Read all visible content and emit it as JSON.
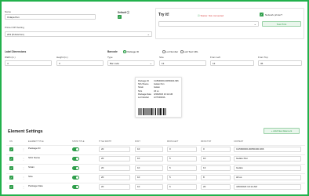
{
  "form": {
    "name_label": "Name",
    "name_value": "Oxlapa Pen",
    "default_label": "Default",
    "printer_dpi_label": "Printer DPI Setting",
    "printer_dpi_value": "203 (8 dots/mm)",
    "label_dimensions_label": "Label Dimensions",
    "width_label": "Width (in.)",
    "width_value": "4",
    "height_label": "Height (in.)",
    "height_value": "3"
  },
  "tryit": {
    "title": "Try it!",
    "status_text": "Status: Not connected",
    "status_icon": "check-square-icon",
    "network_printer_label": "Network printer?",
    "test_print_label": "Test Print"
  },
  "barcode": {
    "label": "Barcode",
    "options": [
      "Package ID",
      "Lot Number",
      "Lab Test URL"
    ],
    "type_label": "Type",
    "type_value": "Bar code",
    "size_label": "Size",
    "size_value": "13",
    "from_left_label": "From Left",
    "from_left_value": "12",
    "from_top_label": "From Top",
    "from_top_value": "36"
  },
  "preview": {
    "lines": [
      {
        "k": "Package ID",
        "v": "CA5M0000-00050400-996"
      },
      {
        "k": "SKU Name",
        "v": "Gelato Pen"
      },
      {
        "k": "Strain",
        "v": "Gelato"
      },
      {
        "k": "Size",
        "v": "All us"
      },
      {
        "k": "Package Date",
        "v": "4/30/2023 10:12 AM"
      },
      {
        "k": "Lot Number",
        "v": "LOT10023A"
      }
    ]
  },
  "elements": {
    "title": "Element Settings",
    "add_button": "+ Add New Element",
    "headers": [
      "ON",
      "ELEMENT TITLE",
      "SHOW TITLE",
      "TITLE WIDTH",
      "FONT",
      "FROM LEFT",
      "FROM TOP",
      "CONTENT"
    ],
    "rows": [
      {
        "title": "Package ID",
        "width": "20",
        "font": "10",
        "left": "0",
        "top": "0",
        "content": "CA5M0000-00050400-996"
      },
      {
        "title": "SKU Name",
        "width": "20",
        "font": "10",
        "left": "5",
        "top": "10",
        "content": "Gelato Pen"
      },
      {
        "title": "Strain",
        "width": "20",
        "font": "10",
        "left": "5",
        "top": "13",
        "content": "Gelato"
      },
      {
        "title": "Size",
        "width": "20",
        "font": "10",
        "left": "5",
        "top": "8",
        "content": "All us"
      },
      {
        "title": "Package Date",
        "width": "20",
        "font": "10",
        "left": "6",
        "top": "20",
        "content": "4/30/2023 10:12 AM"
      }
    ]
  },
  "colors": {
    "accent": "#2e9e4a",
    "frame": "#22b14c",
    "status": "#d94040"
  }
}
